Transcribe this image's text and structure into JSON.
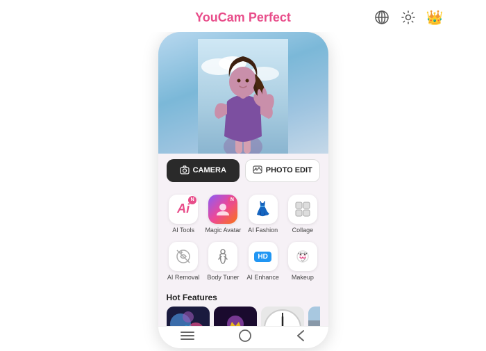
{
  "app": {
    "title_part1": "YouCam",
    "title_part2": " Perfect",
    "icons": {
      "globe": "🌐",
      "settings": "⚙️",
      "crown": "👑"
    }
  },
  "actions": {
    "camera_label": "CAMERA",
    "photo_edit_label": "PHOTO EDIT"
  },
  "tools": [
    {
      "id": "ai-tools",
      "label": "AI Tools",
      "icon": "Ai",
      "badge": "N",
      "type": "ai"
    },
    {
      "id": "magic-avatar",
      "label": "Magic Avatar",
      "icon": "👤",
      "badge": "N",
      "type": "magic"
    },
    {
      "id": "ai-fashion",
      "label": "AI Fashion",
      "icon": "👗",
      "type": "normal"
    },
    {
      "id": "collage",
      "label": "Collage",
      "icon": "🖼",
      "type": "normal"
    },
    {
      "id": "ai-removal",
      "label": "AI Removal",
      "icon": "✨",
      "type": "normal"
    },
    {
      "id": "body-tuner",
      "label": "Body Tuner",
      "icon": "🧍",
      "type": "normal"
    },
    {
      "id": "ai-enhance",
      "label": "AI Enhance",
      "icon": "HD",
      "type": "hd"
    },
    {
      "id": "makeup",
      "label": "Makeup",
      "icon": "💄",
      "type": "normal"
    }
  ],
  "hot_features": {
    "title": "Hot Features",
    "items": [
      {
        "id": "thumb1",
        "type": "colorful1"
      },
      {
        "id": "thumb2",
        "type": "colorful2"
      },
      {
        "id": "thumb3",
        "type": "clock"
      },
      {
        "id": "thumb4",
        "type": "street"
      },
      {
        "id": "thumb5",
        "type": "hat"
      }
    ]
  },
  "nav": {
    "menu_icon": "|||",
    "home_icon": "○",
    "back_icon": "<"
  }
}
